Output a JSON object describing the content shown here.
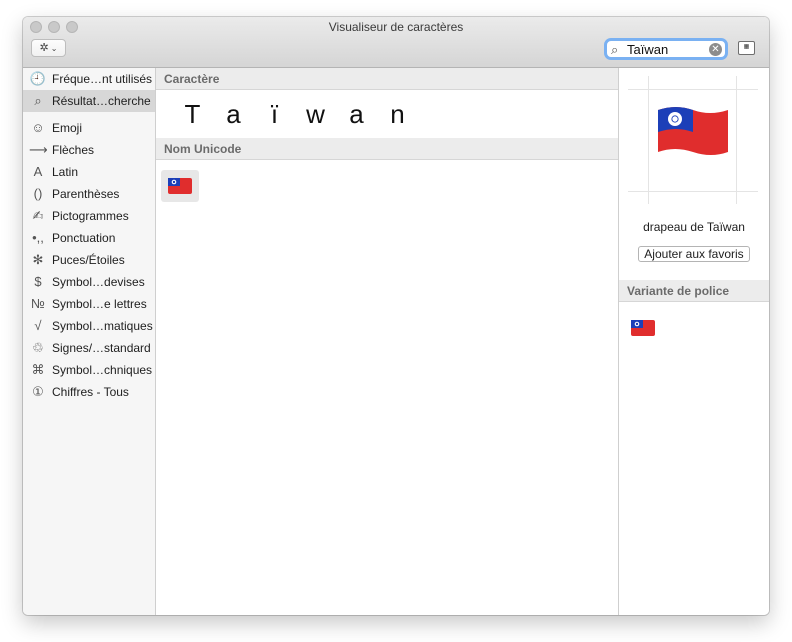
{
  "window": {
    "title": "Visualiseur de caractères"
  },
  "toolbar": {
    "gear_icon": "gear-icon",
    "search_value": "Taïwan",
    "clear_icon": "clear-circle-icon",
    "keyboard_icon": "keyboard-viewer-icon"
  },
  "sidebar": {
    "items": [
      {
        "label": "Fréque…nt utilisés",
        "icon": "clock-icon",
        "glyph": "🕘"
      },
      {
        "label": "Résultat…cherche",
        "icon": "search-icon",
        "glyph": "⌕",
        "selected": true
      },
      {
        "label": "Emoji",
        "icon": "smiley-icon",
        "glyph": "☺"
      },
      {
        "label": "Flèches",
        "icon": "arrow-icon",
        "glyph": "⟶"
      },
      {
        "label": "Latin",
        "icon": "latin-icon",
        "glyph": "A"
      },
      {
        "label": "Parenthèses",
        "icon": "parentheses-icon",
        "glyph": "()"
      },
      {
        "label": "Pictogrammes",
        "icon": "pictogram-icon",
        "glyph": "✍"
      },
      {
        "label": "Ponctuation",
        "icon": "punctuation-icon",
        "glyph": "•,,"
      },
      {
        "label": "Puces/Étoiles",
        "icon": "asterisk-icon",
        "glyph": "✻"
      },
      {
        "label": "Symbol…devises",
        "icon": "dollar-icon",
        "glyph": "$"
      },
      {
        "label": "Symbol…e lettres",
        "icon": "numero-icon",
        "glyph": "№"
      },
      {
        "label": "Symbol…matiques",
        "icon": "sqrt-icon",
        "glyph": "√"
      },
      {
        "label": "Signes/…standard",
        "icon": "recycle-icon",
        "glyph": "♲"
      },
      {
        "label": "Symbol…chniques",
        "icon": "command-icon",
        "glyph": "⌘"
      },
      {
        "label": "Chiffres - Tous",
        "icon": "circled-one-icon",
        "glyph": "①"
      }
    ]
  },
  "main": {
    "char_header": "Caractère",
    "chars": [
      "T",
      "a",
      "ï",
      "w",
      "a",
      "n"
    ],
    "unicode_header": "Nom Unicode",
    "result_icon": "taiwan-flag-icon"
  },
  "detail": {
    "char_name": "drapeau de Taïwan",
    "fav_button": "Ajouter aux favoris",
    "font_variant_header": "Variante de police",
    "flag_colors": {
      "red": "#e02d2d",
      "blue": "#1c3fb8",
      "white": "#ffffff"
    }
  }
}
